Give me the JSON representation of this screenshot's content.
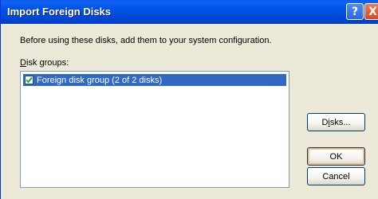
{
  "window": {
    "title": "Import Foreign Disks",
    "help_glyph": "?",
    "close_glyph": "X"
  },
  "dialog": {
    "description": "Before using these disks, add them to your system configuration.",
    "groups_label_accel": "D",
    "groups_label_rest": "isk groups:",
    "list_items": [
      {
        "label": "Foreign disk group (2 of 2 disks)",
        "checked": true,
        "selected": true
      }
    ]
  },
  "buttons": {
    "disks_pre": "D",
    "disks_accel": "i",
    "disks_post": "sks...",
    "ok": "OK",
    "cancel": "Cancel"
  },
  "colors": {
    "titlebar": "#0053e6",
    "selection": "#316ac5",
    "dialog_bg": "#ece9d8"
  }
}
